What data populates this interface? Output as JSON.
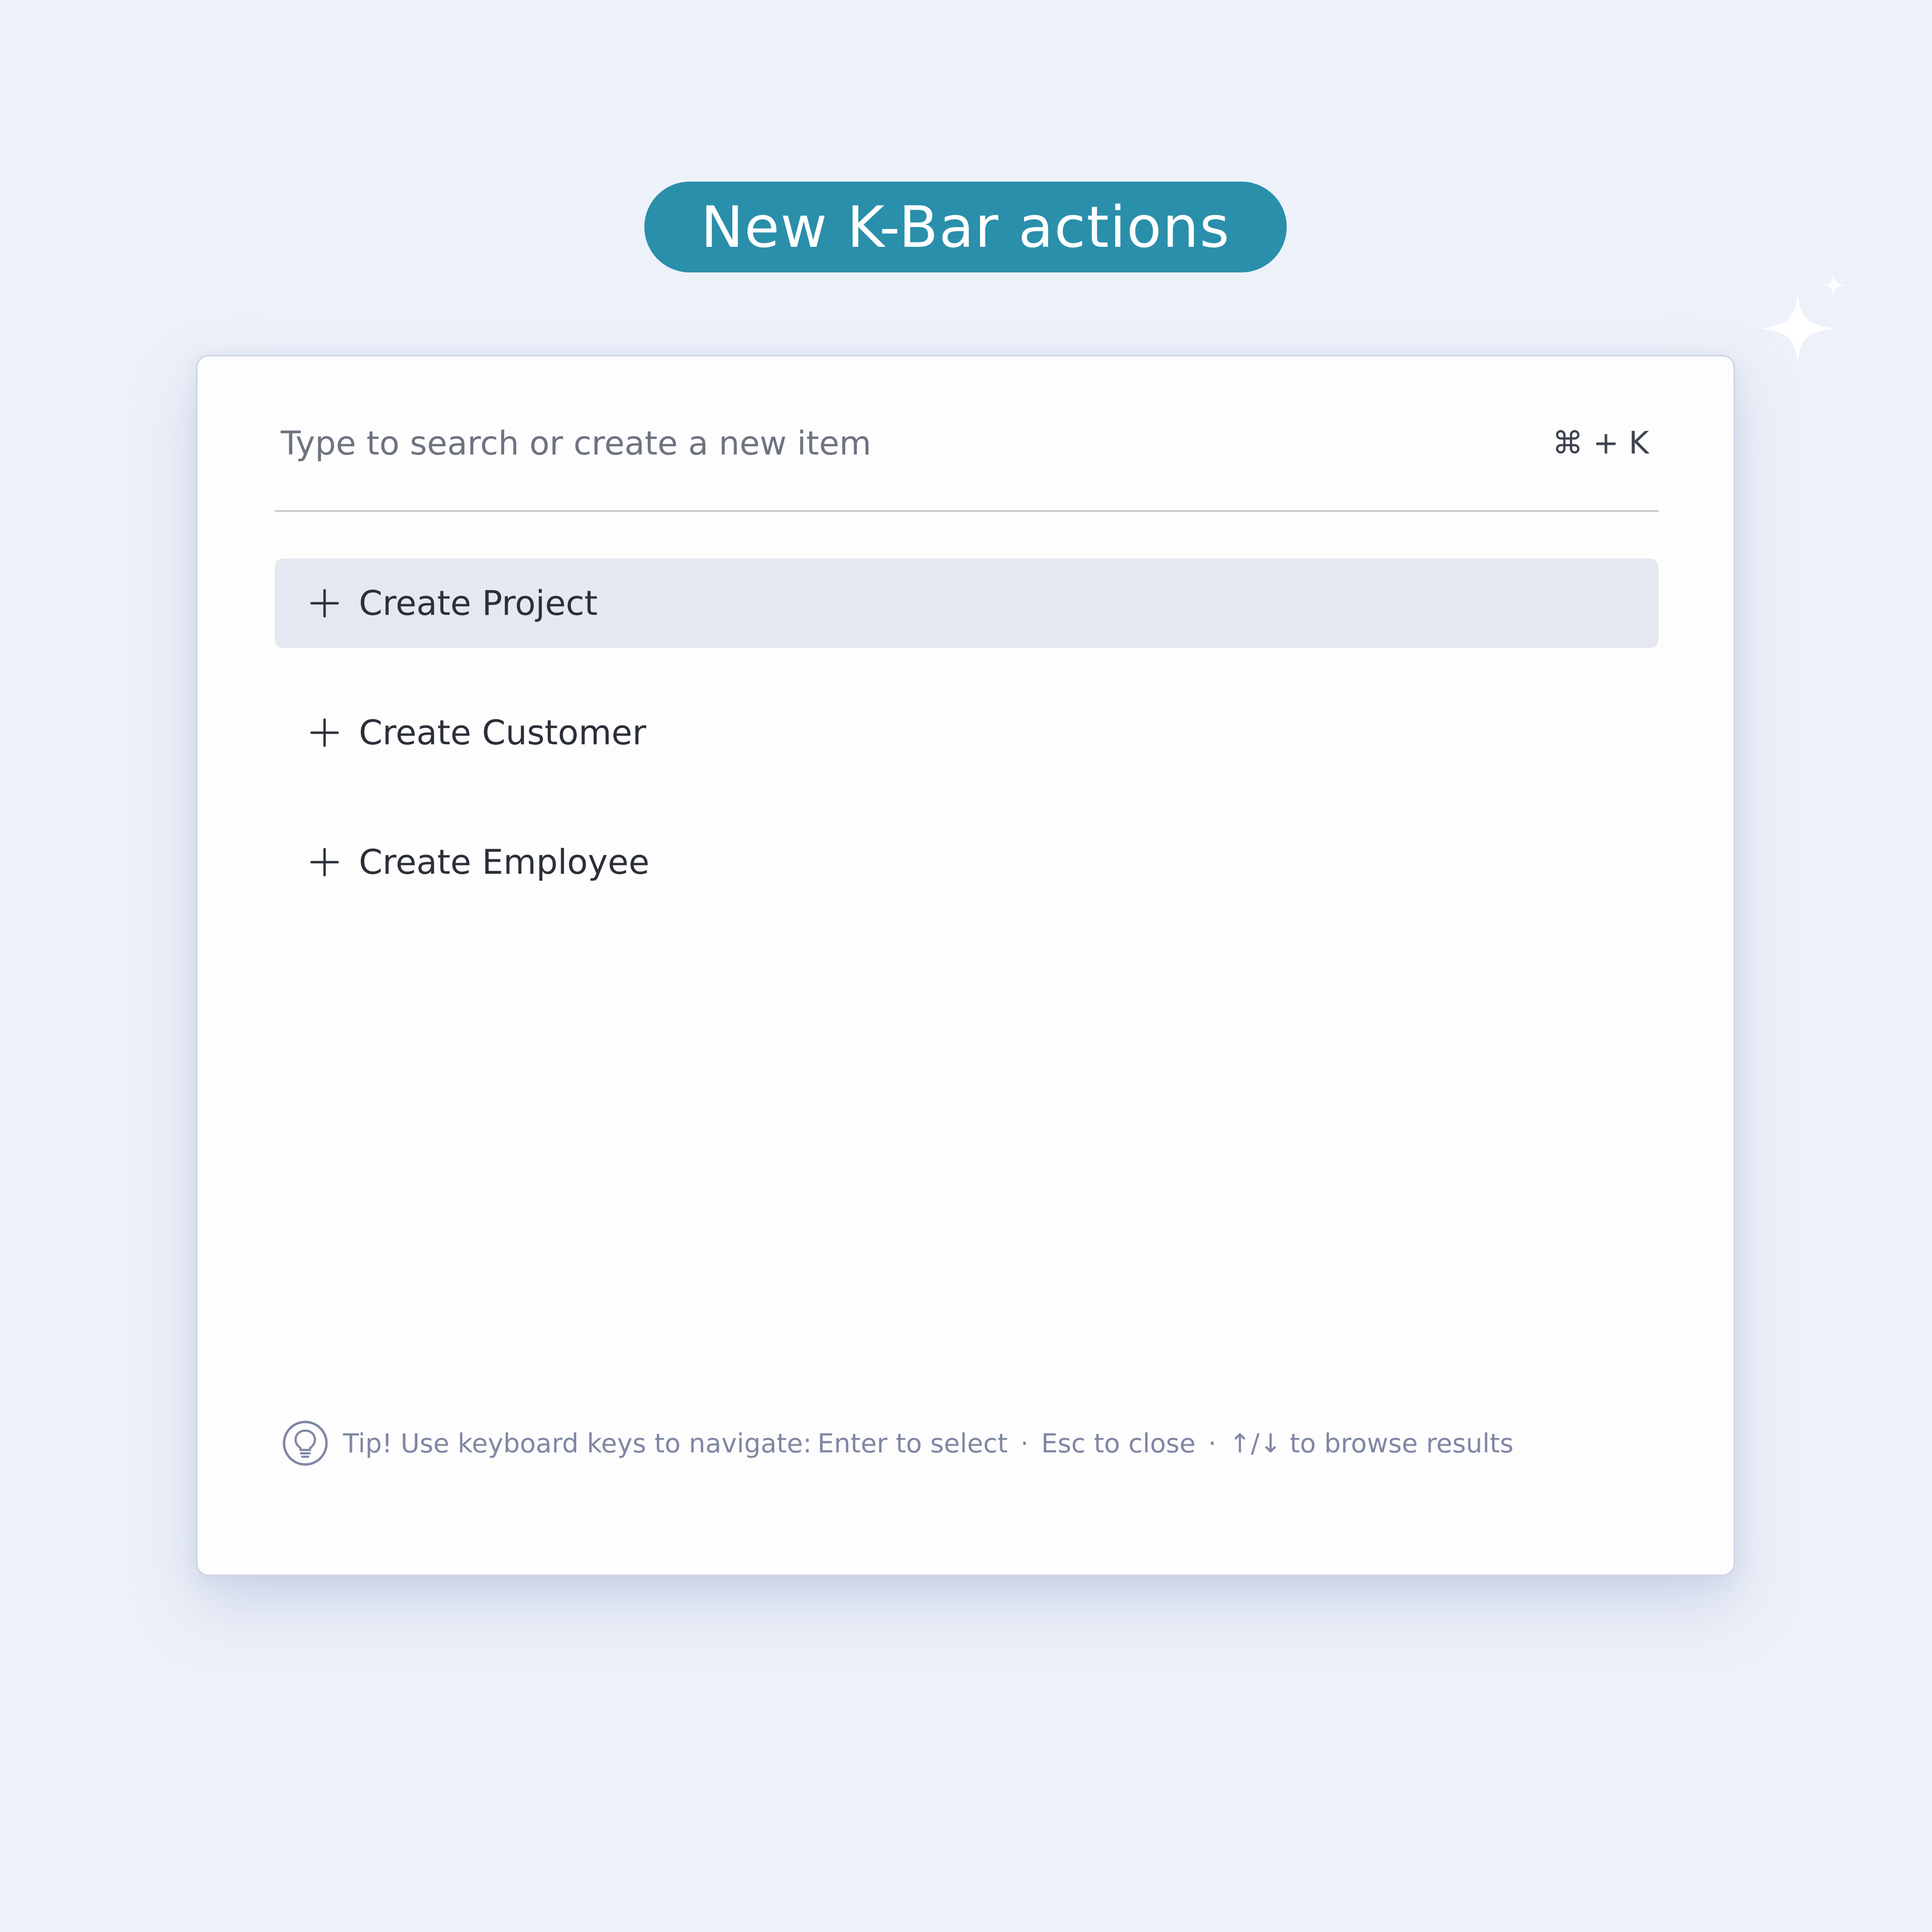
{
  "header": {
    "title": "New K-Bar actions"
  },
  "decoration": {
    "icon": "sparkles-icon",
    "color": "#ffffff"
  },
  "kbar": {
    "search": {
      "placeholder": "Type to search or create a new item",
      "value": ""
    },
    "shortcut": "⌘ + K",
    "actions": [
      {
        "label": "Create Project",
        "icon": "plus-icon",
        "active": true
      },
      {
        "label": "Create Customer",
        "icon": "plus-icon",
        "active": false
      },
      {
        "label": "Create Employee",
        "icon": "plus-icon",
        "active": false
      }
    ],
    "tip": {
      "icon": "lightbulb-icon",
      "lead": "Tip! Use keyboard keys to navigate: ",
      "enter": "Enter to select",
      "sep1": "·",
      "esc": "Esc to close",
      "sep2": "·",
      "arrows": "↑/↓ to browse results"
    }
  },
  "colors": {
    "accent": "#2a8fab",
    "background": "#edf1f9",
    "active_row": "#e5e8f0",
    "tip_text": "#7f87a3"
  }
}
